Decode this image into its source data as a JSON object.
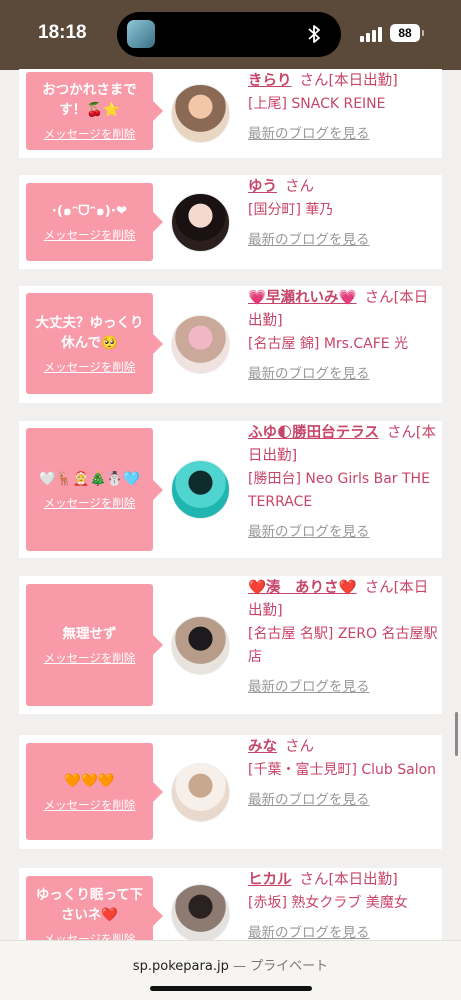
{
  "status_bar": {
    "time": "18:18",
    "battery": "88",
    "bluetooth_icon": "bluetooth-icon"
  },
  "list": {
    "items": [
      {
        "message": "おつかれさまです！🍒⭐",
        "delete_label": "メッセージを削除",
        "name": "きらり",
        "honorific": "さん",
        "status": "[本日出勤]",
        "shop": "[上尾] SNACK REINE",
        "blog_label": "最新のブログを見る",
        "avatar_colors": [
          "#e9d6c2",
          "#f2c6a6",
          "#8a6a55"
        ]
      },
      {
        "message": "·(๑ᵔᗜᵔ๑)·❤",
        "delete_label": "メッセージを削除",
        "name": "ゆう",
        "honorific": "さん",
        "status": "",
        "shop": "[国分町] 華乃",
        "blog_label": "最新のブログを見る",
        "avatar_colors": [
          "#2b1f1e",
          "#f4d9cf",
          "#1a1212"
        ]
      },
      {
        "message": "大丈夫？ゆっくり休んで🥺",
        "delete_label": "メッセージを削除",
        "name": "💗早瀬れいみ💗",
        "honorific": "さん",
        "status": "[本日出勤]",
        "shop": "[名古屋 錦] Mrs.CAFE 光",
        "blog_label": "最新のブログを見る",
        "avatar_colors": [
          "#efe2df",
          "#f1b7c5",
          "#caa99a"
        ]
      },
      {
        "message": "🤍🦌🤶🎄☃️🩵",
        "delete_label": "メッセージを削除",
        "name": "ふゆ🌓勝田台テラス",
        "honorific": "さん",
        "status": "[本日出勤]",
        "shop": "[勝田台] Neo Girls Bar THE TERRACE",
        "blog_label": "最新のブログを見る",
        "avatar_colors": [
          "#1fb6b0",
          "#0f2b2c",
          "#4fd4cf"
        ]
      },
      {
        "message": "無理せず",
        "delete_label": "メッセージを削除",
        "name": "❤️湊　ありさ❤️",
        "honorific": "さん",
        "status": "[本日出勤]",
        "shop": "[名古屋 名駅] ZERO 名古屋駅店",
        "blog_label": "最新のブログを見る",
        "avatar_colors": [
          "#e8e3dc",
          "#1c1a1c",
          "#b79d89"
        ]
      },
      {
        "message": "🧡🧡🧡",
        "delete_label": "メッセージを削除",
        "name": "みな",
        "honorific": "さん",
        "status": "",
        "shop": "[千葉・富士見町] Club Salon",
        "blog_label": "最新のブログを見る",
        "avatar_colors": [
          "#e9d9cd",
          "#c9a890",
          "#f7efe9"
        ]
      },
      {
        "message": "ゆっくり眠って下さいネ❤️",
        "delete_label": "メッセージを削除",
        "name": "ヒカル",
        "honorific": "さん",
        "status": "[本日出勤]",
        "shop": "[赤坂] 熟女クラブ 美魔女",
        "blog_label": "最新のブログを見る",
        "avatar_colors": [
          "#e5e1de",
          "#2a2220",
          "#8d7a70"
        ]
      }
    ]
  },
  "browser": {
    "url": "sp.pokepara.jp",
    "mode": "— プライベート"
  }
}
